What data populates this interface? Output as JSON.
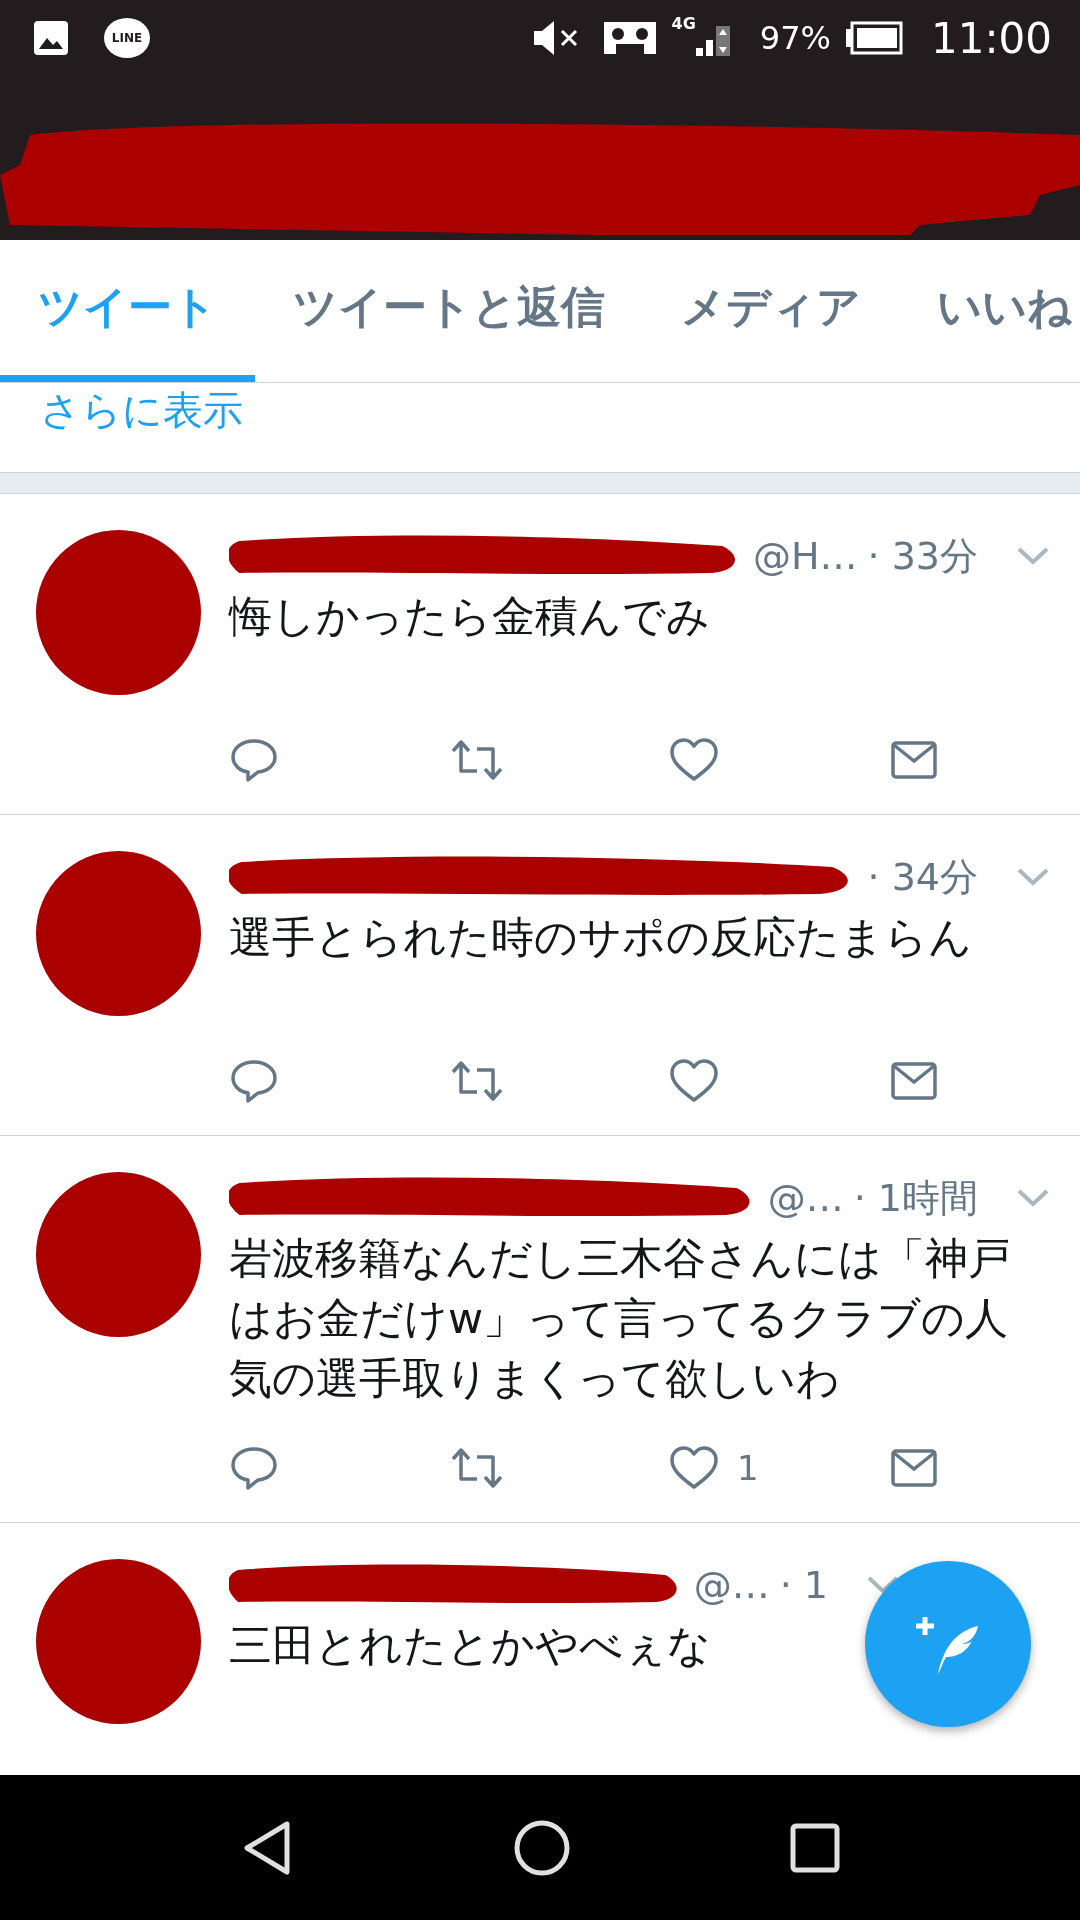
{
  "status_bar": {
    "app_badge": "LINE",
    "network": "4G",
    "battery": "97%",
    "time": "11:00"
  },
  "tabs": [
    {
      "label": "ツイート",
      "selected": true
    },
    {
      "label": "ツイートと返信",
      "selected": false
    },
    {
      "label": "メディア",
      "selected": false
    },
    {
      "label": "いいね",
      "selected": false
    }
  ],
  "show_more": "さらに表示",
  "tweets": [
    {
      "handle": "@H…",
      "time": "· 33分",
      "text": "悔しかったら金積んでみ",
      "actions_shown": true
    },
    {
      "time": "· 34分",
      "text": "選手とられた時のサポの反応たまらん",
      "actions_shown": true
    },
    {
      "handle": "@…",
      "time": "· 1時間",
      "text": "岩波移籍なんだし三木谷さんには「神戸はお金だけw」って言ってるクラブの人気の選手取りまくって欲しいわ",
      "likes": "1",
      "actions_shown": true
    },
    {
      "handle": "@…",
      "time": "· 1",
      "text": "三田とれたとかやべぇな",
      "actions_shown": false
    }
  ]
}
